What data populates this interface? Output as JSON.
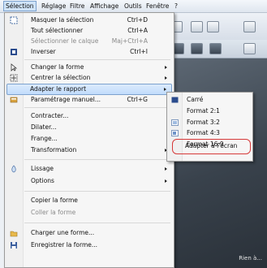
{
  "menubar": {
    "items": [
      "Sélection",
      "Réglage",
      "Filtre",
      "Affichage",
      "Outils",
      "Fenêtre",
      "?"
    ]
  },
  "canvas": {
    "corner_text": "Rien à..."
  },
  "menu": {
    "items": [
      {
        "label": "Masquer la sélection",
        "shortcut": "Ctrl+D",
        "icon": "hide-selection-icon"
      },
      {
        "label": "Tout sélectionner",
        "shortcut": "Ctrl+A"
      },
      {
        "label": "Sélectionner le calque",
        "shortcut": "Maj+Ctrl+A",
        "disabled": true
      },
      {
        "label": "Inverser",
        "shortcut": "Ctrl+I",
        "icon": "invert-icon"
      },
      {
        "label": "Changer la forme",
        "submenu": true,
        "icon": "change-shape-icon"
      },
      {
        "label": "Centrer la sélection",
        "submenu": true,
        "icon": "center-selection-icon"
      },
      {
        "label": "Adapter le rapport",
        "submenu": true,
        "highlighted": true
      },
      {
        "label": "Paramétrage manuel...",
        "shortcut": "Ctrl+G",
        "icon": "manual-settings-icon"
      },
      {
        "label": "Contracter..."
      },
      {
        "label": "Dilater..."
      },
      {
        "label": "Frange..."
      },
      {
        "label": "Transformation",
        "submenu": true
      },
      {
        "label": "Lissage",
        "submenu": true,
        "icon": "smoothing-icon"
      },
      {
        "label": "Options",
        "submenu": true
      },
      {
        "label": "Copier la forme"
      },
      {
        "label": "Coller la forme",
        "disabled": true
      },
      {
        "label": "Charger une forme...",
        "icon": "load-shape-icon"
      },
      {
        "label": "Enregistrer la forme...",
        "icon": "save-shape-icon"
      }
    ]
  },
  "submenu": {
    "items": [
      {
        "label": "Carré",
        "icon": "square-ratio-icon"
      },
      {
        "label": "Format 2:1"
      },
      {
        "label": "Format 3:2",
        "icon": "ratio-3-2-icon"
      },
      {
        "label": "Format 4:3",
        "icon": "ratio-4-3-icon"
      },
      {
        "label": "Format 16:9"
      },
      {
        "label": "Adapter à l'écran"
      }
    ]
  },
  "colors": {
    "highlight_border": "#7da2ce",
    "annotation_circle": "#d63a3a"
  }
}
